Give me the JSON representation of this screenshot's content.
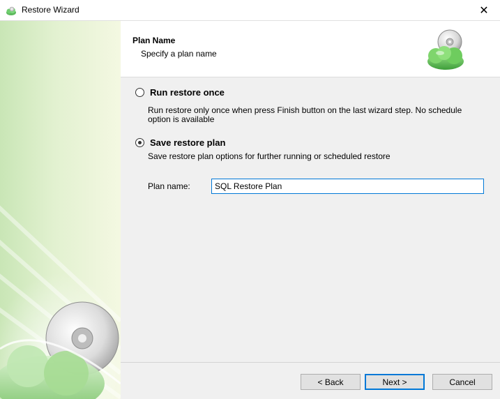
{
  "window": {
    "title": "Restore Wizard",
    "close_glyph": "✕"
  },
  "header": {
    "title": "Plan Name",
    "subtitle": "Specify a plan name"
  },
  "options": [
    {
      "label": "Run restore once",
      "checked": false,
      "description_lines": [
        "Run restore only once when press Finish button on the last wizard step. No schedule",
        "option is available"
      ]
    },
    {
      "label": "Save restore plan",
      "checked": true,
      "description_lines": [
        "Save restore plan options for further running or scheduled restore"
      ]
    }
  ],
  "plan_name": {
    "label": "Plan name:",
    "value": "SQL Restore Plan"
  },
  "buttons": {
    "back": "< Back",
    "next": "Next >",
    "cancel": "Cancel"
  },
  "icons": {
    "app": "cloud-disc-icon",
    "header": "cloud-disc-icon",
    "close": "close-icon"
  },
  "colors": {
    "accent": "#0078d7",
    "sidebar_green": "#c9e6b6"
  }
}
